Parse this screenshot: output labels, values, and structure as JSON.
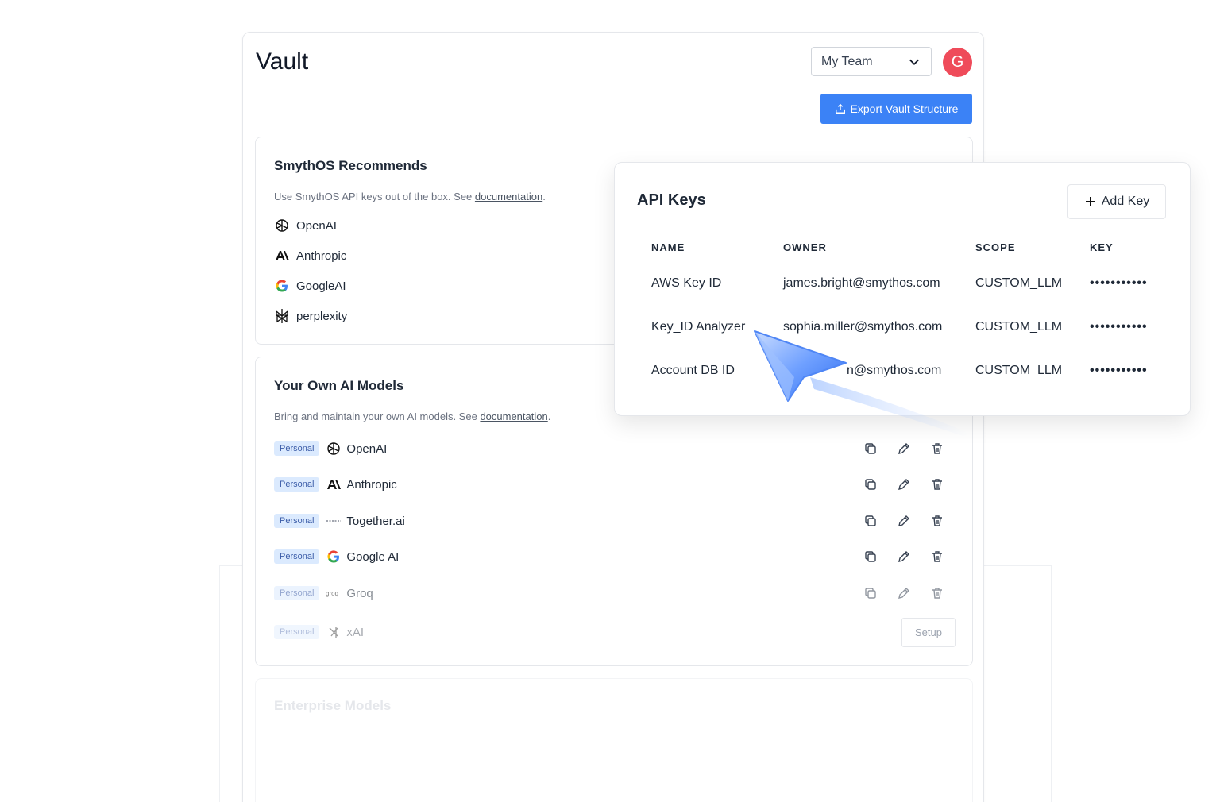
{
  "header": {
    "title": "Vault",
    "team_select": "My Team",
    "avatar_initial": "G",
    "export_button": "Export Vault Structure"
  },
  "recommends": {
    "title": "SmythOS Recommends",
    "desc_prefix": "Use SmythOS API keys out of the box. See ",
    "desc_link": "documentation",
    "desc_suffix": ".",
    "providers": [
      {
        "name": "OpenAI",
        "icon": "openai-icon"
      },
      {
        "name": "Anthropic",
        "icon": "anthropic-icon"
      },
      {
        "name": "GoogleAI",
        "icon": "google-icon"
      },
      {
        "name": "perplexity",
        "icon": "perplexity-icon"
      }
    ]
  },
  "own_models": {
    "title": "Your Own AI Models",
    "desc_prefix": "Bring and maintain your own AI models. See ",
    "desc_link": "documentation",
    "desc_suffix": ".",
    "rows": [
      {
        "badge": "Personal",
        "name": "OpenAI",
        "icon": "openai-icon"
      },
      {
        "badge": "Personal",
        "name": "Anthropic",
        "icon": "anthropic-icon"
      },
      {
        "badge": "Personal",
        "name": "Together.ai",
        "icon": "together-icon"
      },
      {
        "badge": "Personal",
        "name": "Google AI",
        "icon": "google-icon"
      },
      {
        "badge": "Personal",
        "name": "Groq",
        "icon": "groq-icon"
      },
      {
        "badge": "Personal",
        "name": "xAI",
        "icon": "xai-icon",
        "action": "Setup"
      }
    ]
  },
  "enterprise": {
    "title": "Enterprise Models"
  },
  "api_keys": {
    "title": "API Keys",
    "add_button": "Add Key",
    "columns": [
      "NAME",
      "OWNER",
      "SCOPE",
      "KEY"
    ],
    "rows": [
      {
        "name": "AWS Key ID",
        "owner": "james.bright@smythos.com",
        "scope": "CUSTOM_LLM",
        "key": "•••••••••••"
      },
      {
        "name": "Key_ID Analyzer",
        "owner": "sophia.miller@smythos.com",
        "scope": "CUSTOM_LLM",
        "key": "•••••••••••"
      },
      {
        "name": "Account DB ID",
        "owner": "n@smythos.com",
        "scope": "CUSTOM_LLM",
        "key": "•••••••••••"
      }
    ]
  },
  "colors": {
    "accent": "#3b82f6",
    "avatar": "#ef4b5a",
    "badge_bg": "#dbeafe"
  }
}
